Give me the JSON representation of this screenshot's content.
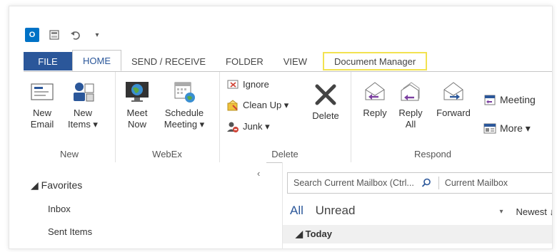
{
  "qat": {
    "logo_text": "O",
    "icons": [
      "outlook-logo-icon",
      "send-receive-all-icon",
      "undo-icon",
      "customize-qat-icon"
    ]
  },
  "tabs": [
    {
      "label": "FILE"
    },
    {
      "label": "HOME"
    },
    {
      "label": "SEND / RECEIVE"
    },
    {
      "label": "FOLDER"
    },
    {
      "label": "VIEW"
    },
    {
      "label": "Document Manager"
    }
  ],
  "ribbon": {
    "new_group": {
      "label": "New",
      "new_email": "New\nEmail",
      "new_items": "New\nItems ▾"
    },
    "webex_group": {
      "label": "WebEx",
      "meet_now": "Meet\nNow",
      "schedule_meeting": "Schedule\nMeeting ▾"
    },
    "delete_group": {
      "label": "Delete",
      "ignore": "Ignore",
      "clean_up": "Clean Up ▾",
      "junk": "Junk ▾",
      "delete": "Delete"
    },
    "respond_group": {
      "label": "Respond",
      "reply": "Reply",
      "reply_all": "Reply\nAll",
      "forward": "Forward",
      "meeting": "Meeting",
      "more": "More ▾"
    }
  },
  "folder_pane": {
    "collapse_icon": "‹",
    "favorites": "◢ Favorites",
    "folders": [
      "Inbox",
      "Sent Items"
    ]
  },
  "mail_pane": {
    "search_placeholder": "Search Current Mailbox (Ctrl...",
    "search_scope": "Current Mailbox",
    "filter_all": "All",
    "filter_unread": "Unread",
    "sort_dropdown": "▾",
    "sort_label": "Newest ↓",
    "group_header": "◢ Today"
  },
  "colors": {
    "file_tab": "#2b579a",
    "accent": "#2b579a",
    "docmgr_highlight": "#f2e250"
  }
}
